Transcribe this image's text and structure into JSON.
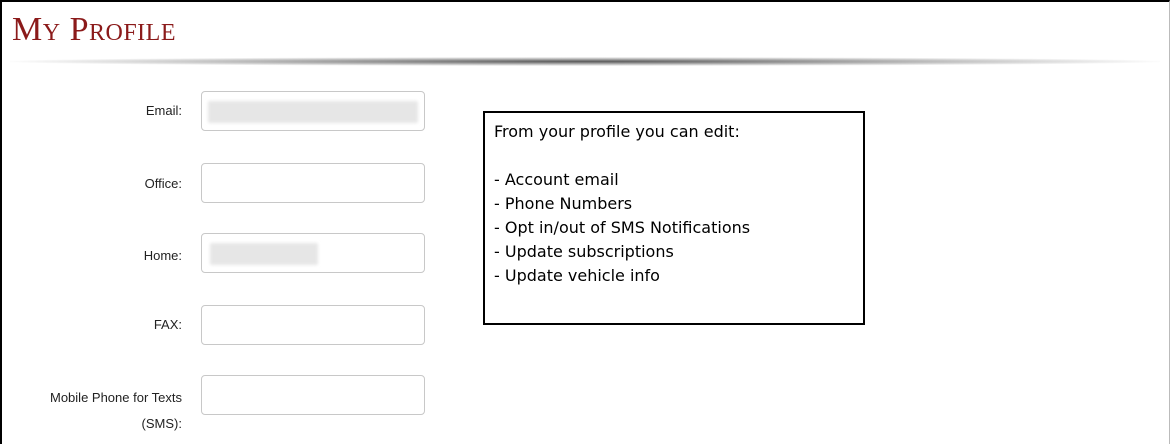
{
  "page": {
    "title": "My Profile"
  },
  "form": {
    "email": {
      "label": "Email:",
      "value": ""
    },
    "office": {
      "label": "Office:",
      "value": ""
    },
    "home": {
      "label": "Home:",
      "value": ""
    },
    "fax": {
      "label": "FAX:",
      "value": ""
    },
    "mobile": {
      "label_line1": "Mobile Phone for Texts",
      "label_line2": "(SMS):",
      "value": ""
    }
  },
  "info_box": {
    "heading": "From your profile you can edit:",
    "items": [
      "Account email",
      "Phone Numbers",
      "Opt in/out of SMS Notifications",
      "Update subscriptions",
      "Update vehicle info"
    ]
  }
}
